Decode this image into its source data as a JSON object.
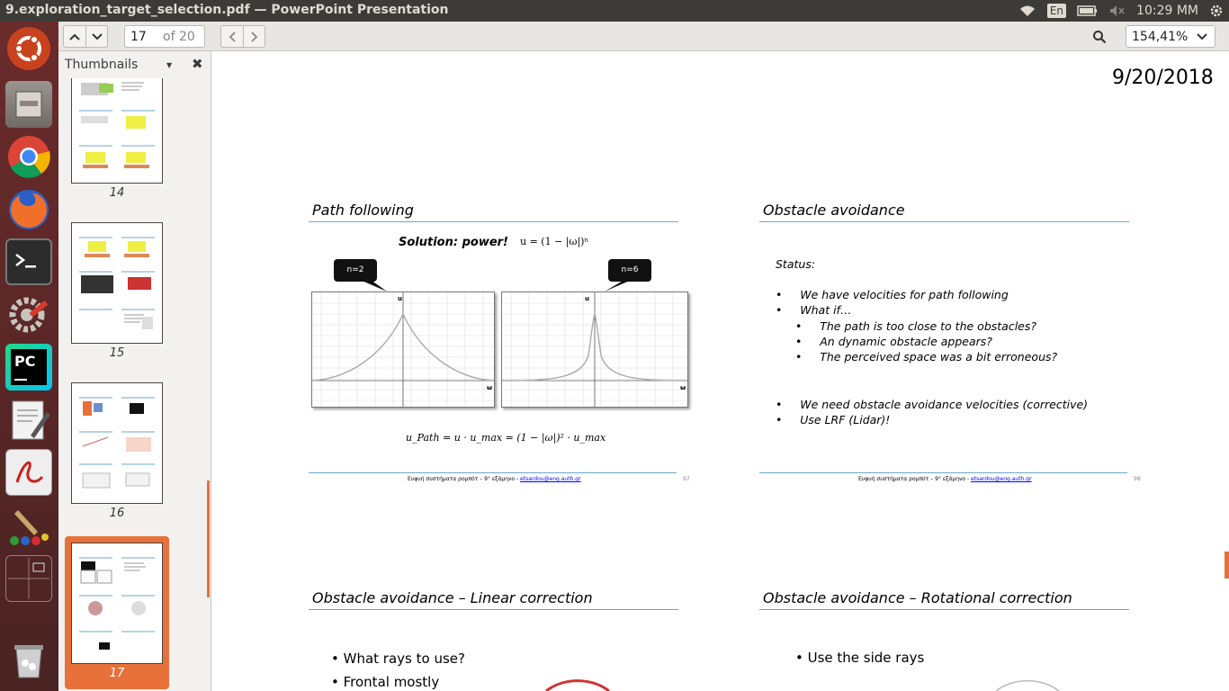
{
  "window_title": "9.exploration_target_selection.pdf — PowerPoint Presentation",
  "tray": {
    "lang": "En",
    "clock": "10:29 MM"
  },
  "launcher": [
    "ubuntu-icon",
    "files-icon",
    "chrome-icon",
    "firefox-icon",
    "terminal-icon",
    "settings-icon",
    "pycharm-icon",
    "text-editor-icon",
    "pdf-viewer-icon",
    "paint-icon",
    "workspace-icon",
    "trash-icon"
  ],
  "toolbar": {
    "page_value": "17",
    "page_total": "of 20",
    "zoom": "154,41%"
  },
  "sidebar": {
    "header": "Thumbnails",
    "thumbs": [
      "14",
      "15",
      "16",
      "17"
    ],
    "selected": "17"
  },
  "doc": {
    "date": "9/20/2018",
    "slide1": {
      "title": "Path following",
      "solution": "Solution: power!",
      "formula": "u = (1 − |ω|)ⁿ",
      "callout1": "n=2",
      "callout2": "n=6",
      "axis_u": "u",
      "axis_w": "ω",
      "bottom_formula": "u_Path = u · u_max = (1 − |ω|)² · u_max",
      "footer_text": "Ευφυή συστήματα ρομπότ – 9° εξάμηνο - ",
      "footer_link": "etsardou@eng.auth.gr",
      "page": "97"
    },
    "slide2": {
      "title": "Obstacle avoidance",
      "status": "Status:",
      "b1": "We have velocities for path following",
      "b2": "What if…",
      "b3": "The path is too close to the obstacles?",
      "b4": "An dynamic obstacle appears?",
      "b5": "The perceived space was a bit erroneous?",
      "b6": "We need obstacle avoidance velocities (corrective)",
      "b7": "Use LRF (Lidar)!",
      "footer_text": "Ευφυή συστήματα ρομπότ – 9° εξάμηνο - ",
      "footer_link": "etsardou@eng.auth.gr",
      "page": "98"
    },
    "slide3": {
      "title": "Obstacle avoidance – Linear correction",
      "b1": "What rays to use?",
      "b2": "Frontal mostly"
    },
    "slide4": {
      "title": "Obstacle avoidance – Rotational correction",
      "b1": "Use the side rays"
    }
  },
  "colors": {
    "topbar": "#3c3b37",
    "launcher": "#5a2a2a",
    "accent": "#e8703a",
    "slide_line": "#6aa8c9"
  }
}
